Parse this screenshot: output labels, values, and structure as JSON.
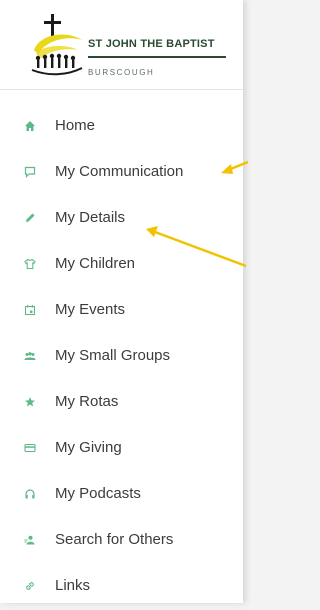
{
  "header": {
    "church_name": "ST JOHN THE BAPTIST",
    "town": "BURSCOUGH"
  },
  "menu": {
    "items": [
      {
        "label": "Home",
        "icon": "home-icon"
      },
      {
        "label": "My Communication",
        "icon": "chat-icon"
      },
      {
        "label": "My Details",
        "icon": "pencil-icon"
      },
      {
        "label": "My Children",
        "icon": "shirt-icon"
      },
      {
        "label": "My Events",
        "icon": "calendar-icon"
      },
      {
        "label": "My Small Groups",
        "icon": "group-icon"
      },
      {
        "label": "My Rotas",
        "icon": "star-icon"
      },
      {
        "label": "My Giving",
        "icon": "card-icon"
      },
      {
        "label": "My Podcasts",
        "icon": "headphones-icon"
      },
      {
        "label": "Search for Others",
        "icon": "person-search-icon"
      },
      {
        "label": "Links",
        "icon": "link-icon"
      }
    ]
  },
  "colors": {
    "icon": "#5fb88a",
    "text": "#3c3c3c",
    "brand": "#2b4a30",
    "logo_yellow": "#e9d81a",
    "annotation_arrow": "#f2c200"
  }
}
